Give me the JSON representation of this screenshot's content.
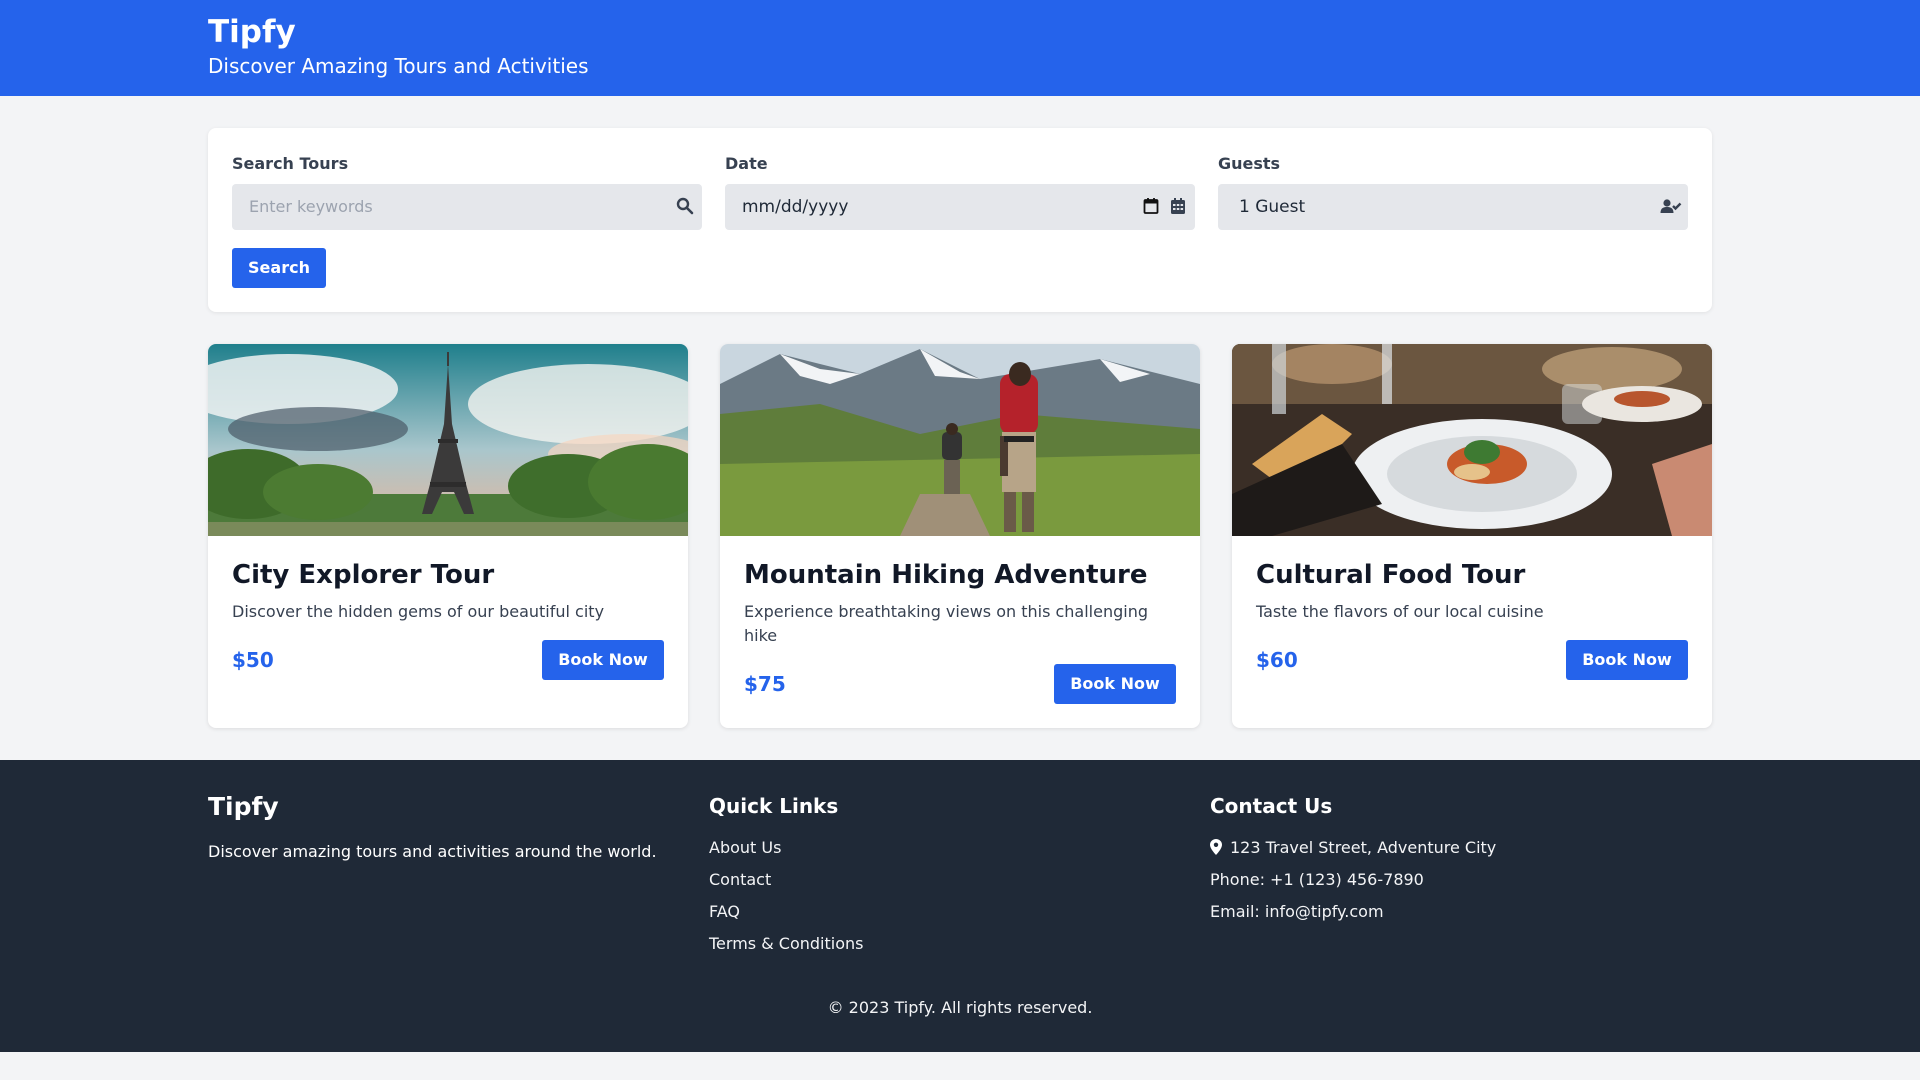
{
  "header": {
    "brand": "Tipfy",
    "tagline": "Discover Amazing Tours and Activities"
  },
  "search": {
    "label_keywords": "Search Tours",
    "keywords_placeholder": "Enter keywords",
    "label_date": "Date",
    "date_value": "mm/dd/yyyy",
    "label_guests": "Guests",
    "guests_value": "1 Guest",
    "search_button": "Search"
  },
  "tours": [
    {
      "title": "City Explorer Tour",
      "description": "Discover the hidden gems of our beautiful city",
      "price": "$50",
      "button": "Book Now",
      "image_icon": "eiffel-tower-photo"
    },
    {
      "title": "Mountain Hiking Adventure",
      "description": "Experience breathtaking views on this challenging hike",
      "price": "$75",
      "button": "Book Now",
      "image_icon": "mountain-hikers-photo"
    },
    {
      "title": "Cultural Food Tour",
      "description": "Taste the flavors of our local cuisine",
      "price": "$60",
      "button": "Book Now",
      "image_icon": "food-plate-photo"
    }
  ],
  "footer": {
    "brand": "Tipfy",
    "about": "Discover amazing tours and activities around the world.",
    "quick_links_heading": "Quick Links",
    "links": [
      "About Us",
      "Contact",
      "FAQ",
      "Terms & Conditions"
    ],
    "contact_heading": "Contact Us",
    "address": "123 Travel Street, Adventure City",
    "phone": "Phone: +1 (123) 456-7890",
    "email": "Email: info@tipfy.com",
    "copyright": "© 2023 Tipfy. All rights reserved."
  },
  "colors": {
    "brand_blue": "#2563eb",
    "footer_bg": "#1f2937",
    "page_bg": "#f3f4f6"
  }
}
